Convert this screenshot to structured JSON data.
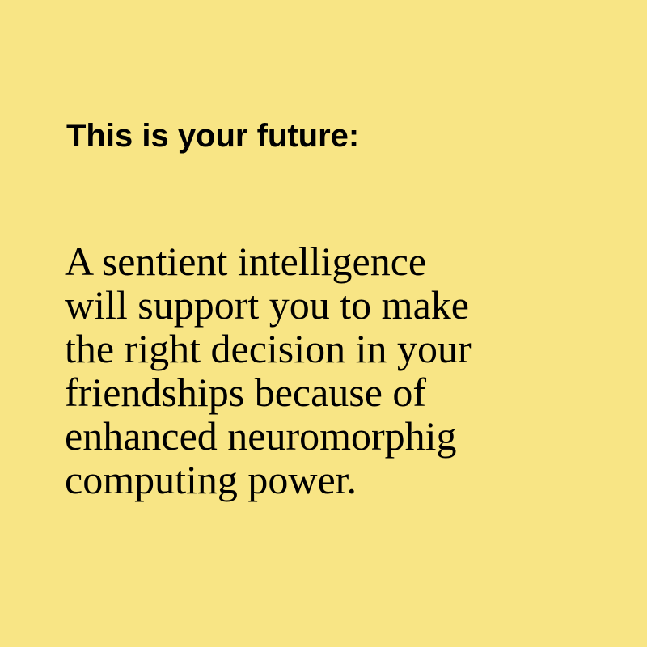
{
  "background_color": "#f8e585",
  "text_color": "#000000",
  "headline": "This is your future:",
  "body_lines": [
    "A sentient intelligence",
    "will support you to make",
    "the right decision in your",
    "friendships because of",
    "enhanced neuromorphig",
    "computing power."
  ]
}
